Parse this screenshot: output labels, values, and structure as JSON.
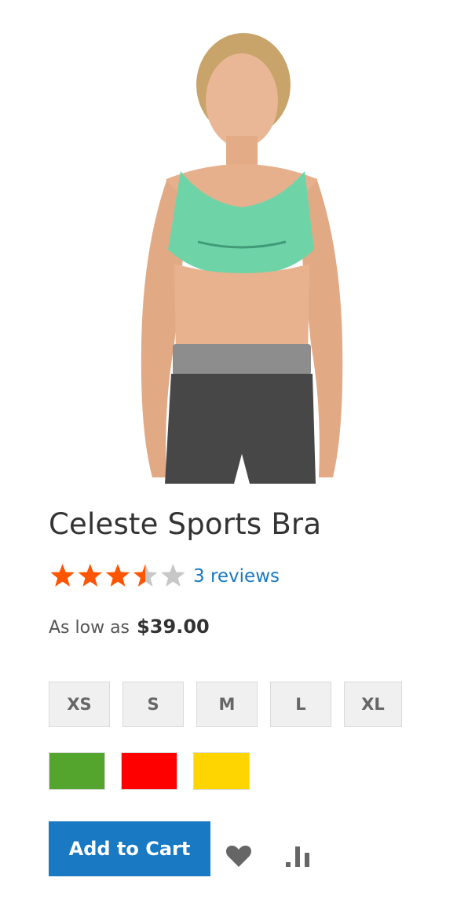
{
  "product": {
    "name": "Celeste Sports Bra",
    "rating": 3.5,
    "rating_max": 5,
    "reviews_link": "3 reviews",
    "price_label": "As low as",
    "price": "$39.00"
  },
  "sizes": [
    "XS",
    "S",
    "M",
    "L",
    "XL"
  ],
  "colors": [
    {
      "name": "green",
      "hex": "#53a52e"
    },
    {
      "name": "red",
      "hex": "#ff0000"
    },
    {
      "name": "yellow",
      "hex": "#ffd500"
    }
  ],
  "actions": {
    "add_to_cart": "Add to Cart",
    "wishlist_icon": "heart-icon",
    "compare_icon": "bar-chart-icon"
  },
  "theme": {
    "accent": "#1979c3",
    "star_filled": "#ff5501",
    "star_empty": "#c7c7c7"
  }
}
